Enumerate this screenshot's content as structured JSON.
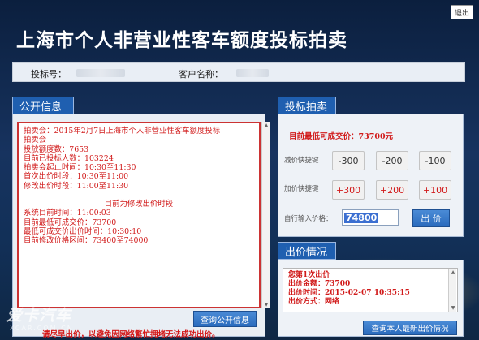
{
  "header": {
    "title": "上海市个人非营业性客车额度投标拍卖",
    "exit_label": "退出"
  },
  "info_bar": {
    "bid_no_label": "投标号：",
    "client_name_label": "客户名称："
  },
  "public_info": {
    "title": "公开信息",
    "lines": [
      "拍卖会：2015年2月7日上海市个人非营业性客车额度投标",
      "拍卖会",
      "投放额度数：7653",
      "目前已投标人数：103224",
      "拍卖会起止时间：10:30至11:30",
      "首次出价时段：10:30至11:00",
      "修改出价时段：11:00至11:30"
    ],
    "stage_notice": "目前为修改出价时段",
    "lines2": [
      "系统目前时间：11:00:03",
      "目前最低可成交价：73700",
      "最低可成交价出价时间：10:30:10",
      "目前修改价格区间：73400至74000"
    ],
    "query_button": "查询公开信息",
    "warning": "请尽早出价，以避免因网络繁忙拥堵无法成功出价。"
  },
  "bidding": {
    "title": "投标拍卖",
    "min_price_text": "目前最低可成交价：73700元",
    "decrease_label": "减价快捷键",
    "increase_label": "加价快捷键",
    "decrease_buttons": [
      "-300",
      "-200",
      "-100"
    ],
    "increase_buttons": [
      "+300",
      "+200",
      "+100"
    ],
    "custom_price_label": "自行输入价格：",
    "custom_price_value": "74800",
    "bid_button": "出 价"
  },
  "bid_status": {
    "title": "出价情况",
    "lines": [
      "您第1次出价",
      "出价金额：73700",
      "出价时间：2015-02-07 10:35:15",
      "出价方式：网络"
    ],
    "query_button": "查询本人最新出价情况"
  },
  "watermark": {
    "text": "爱卡汽车",
    "sub": "XCAR.COM.CN"
  },
  "colors": {
    "accent_blue": "#1f5fb0",
    "announce_red": "#d11a1a",
    "background": "#17335f"
  }
}
